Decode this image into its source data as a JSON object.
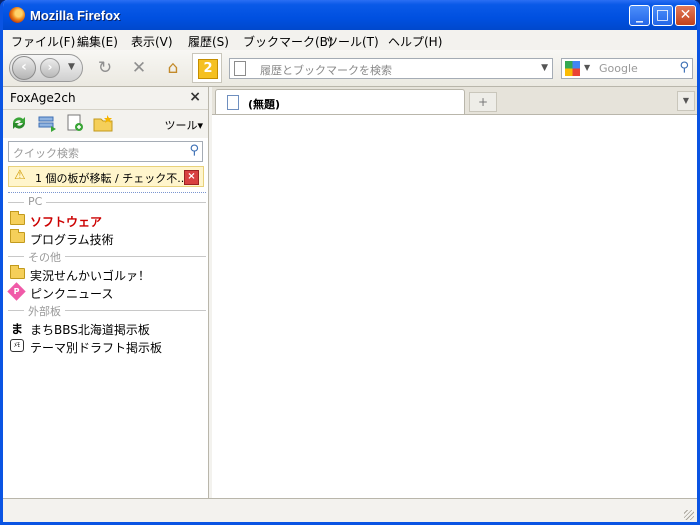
{
  "window": {
    "title": "Mozilla Firefox"
  },
  "menu": [
    "ファイル(F)",
    "編集(E)",
    "表示(V)",
    "履歴(S)",
    "ブックマーク(B)",
    "ツール(T)",
    "ヘルプ(H)"
  ],
  "toolbar": {
    "badge_number": "2",
    "url_placeholder": "履歴とブックマークを検索",
    "search_placeholder": "Google"
  },
  "sidebar": {
    "title": "FoxAge2ch",
    "tools_label": "ツール▾",
    "quick_search_placeholder": "クイック検索",
    "notice_text": "1 個の板が移転 / チェック不...",
    "tree": {
      "sep_pc": "PC",
      "item_software": "ソフトウェア",
      "item_programming": "プログラム技術",
      "sep_other": "その他",
      "item_jikkyo": "実況せんかいゴルァ！",
      "item_pink": "ピンクニュース",
      "sep_external": "外部板",
      "item_machi": "まちBBS北海道掲示板",
      "item_theme": "テーマ別ドラフト掲示板"
    }
  },
  "tabs": [
    {
      "label": "(無題)"
    }
  ],
  "icons": {
    "machi_glyph": "ま",
    "theme_glyph": "ﾒﾓ"
  }
}
